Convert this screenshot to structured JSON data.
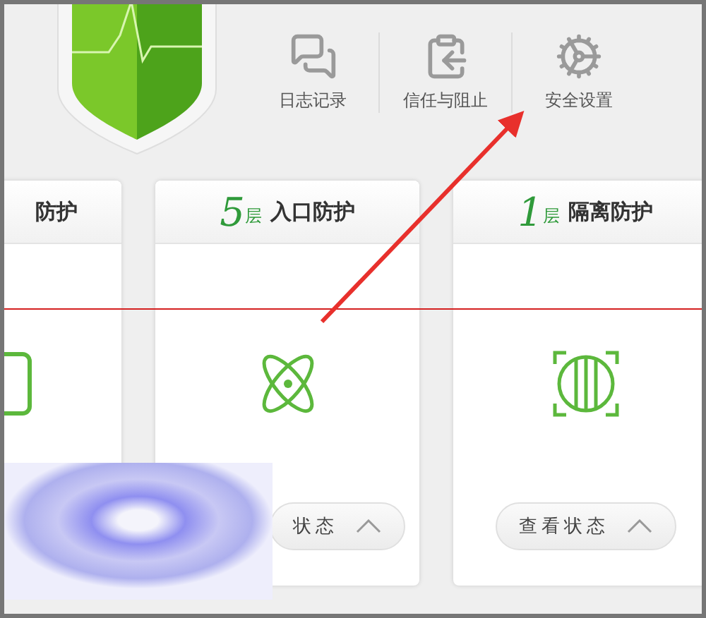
{
  "toolbar": [
    {
      "kind": "log",
      "label": "日志记录"
    },
    {
      "kind": "trust",
      "label": "信任与阻止"
    },
    {
      "kind": "settings",
      "label": "安全设置"
    }
  ],
  "cards": [
    {
      "kind": "partial",
      "title": "防护"
    },
    {
      "kind": "entry",
      "count": "5",
      "unit": "层",
      "title": "入口防护",
      "button": "状态"
    },
    {
      "kind": "isolation",
      "count": "1",
      "unit": "层",
      "title": "隔离防护",
      "button": "查看状态"
    }
  ]
}
